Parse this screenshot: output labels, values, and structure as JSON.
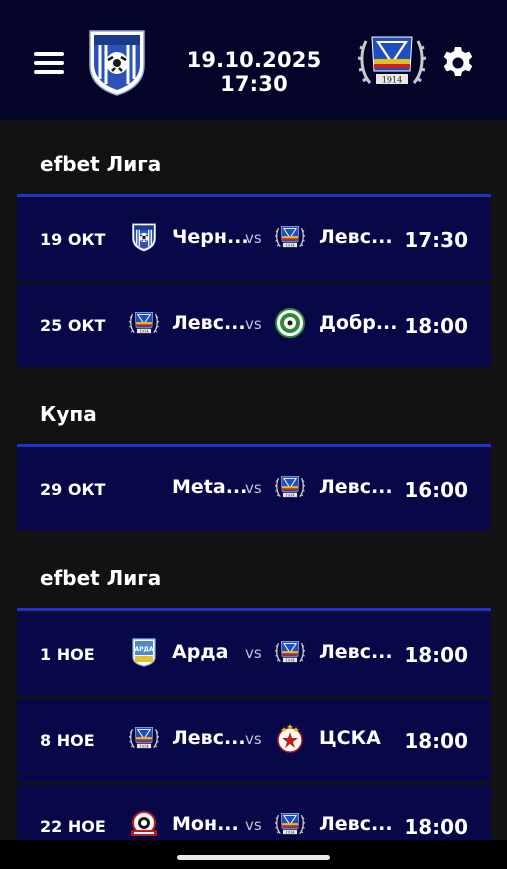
{
  "header": {
    "datetime": "19.10.2025 17:30",
    "home_team": "Черно море",
    "away_team": "Левски"
  },
  "sections": [
    {
      "title": "efbet Лига",
      "matches": [
        {
          "date": "19 ОКТ",
          "home": "Черн...",
          "vs": "vs",
          "away": "Левс...",
          "time": "17:30"
        },
        {
          "date": "25 ОКТ",
          "home": "Левс...",
          "vs": "vs",
          "away": "Добр...",
          "time": "18:00"
        }
      ]
    },
    {
      "title": "Купа",
      "matches": [
        {
          "date": "29 ОКТ",
          "home": "Meta...",
          "vs": "vs",
          "away": "Левс...",
          "time": "16:00"
        }
      ]
    },
    {
      "title": "efbet Лига",
      "matches": [
        {
          "date": "1 НОЕ",
          "home": "Арда",
          "vs": "vs",
          "away": "Левс...",
          "time": "18:00"
        },
        {
          "date": "8 НОЕ",
          "home": "Левс...",
          "vs": "vs",
          "away": "ЦСКА",
          "time": "18:00"
        },
        {
          "date": "22 НОЕ",
          "home": "Мон...",
          "vs": "vs",
          "away": "Левс...",
          "time": "18:00"
        }
      ]
    }
  ],
  "icons": {
    "menu": "hamburger-menu-icon",
    "settings": "gear-icon"
  },
  "colors": {
    "header_bg": "#05052a",
    "row_bg": "#080848",
    "accent": "#1f2fd6",
    "page_bg": "#121212"
  }
}
